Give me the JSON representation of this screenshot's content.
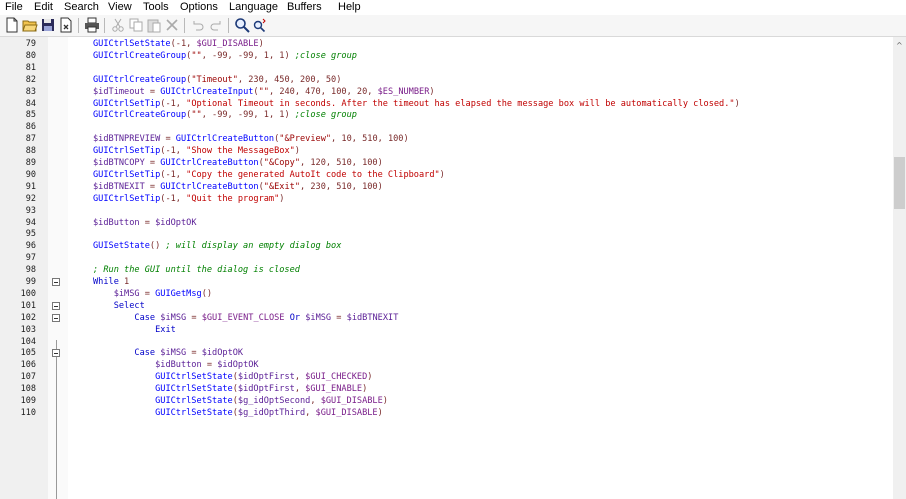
{
  "menu": [
    "File",
    "Edit",
    "Search",
    "View",
    "Tools",
    "Options",
    "Language",
    "Buffers",
    "Help"
  ],
  "toolbar": {
    "icons": [
      "new-file-icon",
      "open-folder-icon",
      "save-icon",
      "close-file-icon",
      "print-icon",
      "cut-icon",
      "copy-icon",
      "paste-icon",
      "delete-icon",
      "undo-icon",
      "redo-icon",
      "find-icon",
      "replace-icon"
    ]
  },
  "editor": {
    "lines": [
      {
        "n": "79",
        "fold": false,
        "segs": [
          [
            "fn",
            "GUICtrlSetState"
          ],
          [
            "op",
            "(-1, "
          ],
          [
            "mac",
            "$GUI_DISABLE"
          ],
          [
            "op",
            ")"
          ]
        ]
      },
      {
        "n": "80",
        "fold": false,
        "segs": [
          [
            "fn",
            "GUICtrlCreateGroup"
          ],
          [
            "op",
            "("
          ],
          [
            "str",
            "\"\""
          ],
          [
            "op",
            ", -99, -99, 1, 1) "
          ],
          [
            "cm",
            ";close group"
          ]
        ]
      },
      {
        "n": "81",
        "fold": false,
        "segs": []
      },
      {
        "n": "82",
        "fold": false,
        "segs": [
          [
            "fn",
            "GUICtrlCreateGroup"
          ],
          [
            "op",
            "("
          ],
          [
            "str",
            "\"Timeout\""
          ],
          [
            "op",
            ", 230, 450, 200, 50)"
          ]
        ]
      },
      {
        "n": "83",
        "fold": false,
        "segs": [
          [
            "var",
            "$idTimeout"
          ],
          [
            "op",
            " = "
          ],
          [
            "fn",
            "GUICtrlCreateInput"
          ],
          [
            "op",
            "("
          ],
          [
            "str",
            "\"\""
          ],
          [
            "op",
            ", 240, 470, 100, 20, "
          ],
          [
            "mac",
            "$ES_NUMBER"
          ],
          [
            "op",
            ")"
          ]
        ]
      },
      {
        "n": "84",
        "fold": false,
        "segs": [
          [
            "fn",
            "GUICtrlSetTip"
          ],
          [
            "op",
            "(-1, "
          ],
          [
            "str2",
            "\"Optional Timeout in seconds. After the timeout has elapsed the message box will be automatically closed.\""
          ],
          [
            "op",
            ")"
          ]
        ]
      },
      {
        "n": "85",
        "fold": false,
        "segs": [
          [
            "fn",
            "GUICtrlCreateGroup"
          ],
          [
            "op",
            "("
          ],
          [
            "str",
            "\"\""
          ],
          [
            "op",
            ", -99, -99, 1, 1) "
          ],
          [
            "cm",
            ";close group"
          ]
        ]
      },
      {
        "n": "86",
        "fold": false,
        "segs": []
      },
      {
        "n": "87",
        "fold": false,
        "segs": [
          [
            "var",
            "$idBTNPREVIEW"
          ],
          [
            "op",
            " = "
          ],
          [
            "fn",
            "GUICtrlCreateButton"
          ],
          [
            "op",
            "("
          ],
          [
            "str",
            "\"&Preview\""
          ],
          [
            "op",
            ", 10, 510, 100)"
          ]
        ]
      },
      {
        "n": "88",
        "fold": false,
        "segs": [
          [
            "fn",
            "GUICtrlSetTip"
          ],
          [
            "op",
            "(-1, "
          ],
          [
            "str2",
            "\"Show the MessageBox\""
          ],
          [
            "op",
            ")"
          ]
        ]
      },
      {
        "n": "89",
        "fold": false,
        "segs": [
          [
            "var",
            "$idBTNCOPY"
          ],
          [
            "op",
            " = "
          ],
          [
            "fn",
            "GUICtrlCreateButton"
          ],
          [
            "op",
            "("
          ],
          [
            "str",
            "\"&Copy\""
          ],
          [
            "op",
            ", 120, 510, 100)"
          ]
        ]
      },
      {
        "n": "90",
        "fold": false,
        "segs": [
          [
            "fn",
            "GUICtrlSetTip"
          ],
          [
            "op",
            "(-1, "
          ],
          [
            "str2",
            "\"Copy the generated AutoIt code to the Clipboard\""
          ],
          [
            "op",
            ")"
          ]
        ]
      },
      {
        "n": "91",
        "fold": false,
        "segs": [
          [
            "var",
            "$idBTNEXIT"
          ],
          [
            "op",
            " = "
          ],
          [
            "fn",
            "GUICtrlCreateButton"
          ],
          [
            "op",
            "("
          ],
          [
            "str",
            "\"&Exit\""
          ],
          [
            "op",
            ", 230, 510, 100)"
          ]
        ]
      },
      {
        "n": "92",
        "fold": false,
        "segs": [
          [
            "fn",
            "GUICtrlSetTip"
          ],
          [
            "op",
            "(-1, "
          ],
          [
            "str2",
            "\"Quit the program\""
          ],
          [
            "op",
            ")"
          ]
        ]
      },
      {
        "n": "93",
        "fold": false,
        "segs": []
      },
      {
        "n": "94",
        "fold": false,
        "segs": [
          [
            "var",
            "$idButton"
          ],
          [
            "op",
            " = "
          ],
          [
            "var",
            "$idOptOK"
          ]
        ]
      },
      {
        "n": "95",
        "fold": false,
        "segs": []
      },
      {
        "n": "96",
        "fold": false,
        "segs": [
          [
            "fn",
            "GUISetState"
          ],
          [
            "op",
            "() "
          ],
          [
            "cm",
            "; will display an empty dialog box"
          ]
        ]
      },
      {
        "n": "97",
        "fold": false,
        "segs": []
      },
      {
        "n": "98",
        "fold": false,
        "segs": [
          [
            "cm",
            "; Run the GUI until the dialog is closed"
          ]
        ]
      },
      {
        "n": "99",
        "fold": true,
        "segs": [
          [
            "kw",
            "While"
          ],
          [
            "op",
            " 1"
          ]
        ]
      },
      {
        "n": "100",
        "fold": false,
        "segs": [
          [
            "op",
            "    "
          ],
          [
            "var",
            "$iMSG"
          ],
          [
            "op",
            " = "
          ],
          [
            "fn",
            "GUIGetMsg"
          ],
          [
            "op",
            "()"
          ]
        ]
      },
      {
        "n": "101",
        "fold": true,
        "segs": [
          [
            "op",
            "    "
          ],
          [
            "kw",
            "Select"
          ]
        ]
      },
      {
        "n": "102",
        "fold": true,
        "segs": [
          [
            "op",
            "        "
          ],
          [
            "kw",
            "Case"
          ],
          [
            "op",
            " "
          ],
          [
            "var",
            "$iMSG"
          ],
          [
            "op",
            " = "
          ],
          [
            "mac",
            "$GUI_EVENT_CLOSE"
          ],
          [
            "op",
            " "
          ],
          [
            "kw",
            "Or"
          ],
          [
            "op",
            " "
          ],
          [
            "var",
            "$iMSG"
          ],
          [
            "op",
            " = "
          ],
          [
            "var",
            "$idBTNEXIT"
          ]
        ]
      },
      {
        "n": "103",
        "fold": false,
        "segs": [
          [
            "op",
            "            "
          ],
          [
            "kw",
            "Exit"
          ]
        ]
      },
      {
        "n": "104",
        "fold": false,
        "segs": []
      },
      {
        "n": "105",
        "fold": true,
        "segs": [
          [
            "op",
            "        "
          ],
          [
            "kw",
            "Case"
          ],
          [
            "op",
            " "
          ],
          [
            "var",
            "$iMSG"
          ],
          [
            "op",
            " = "
          ],
          [
            "var",
            "$idOptOK"
          ]
        ]
      },
      {
        "n": "106",
        "fold": false,
        "segs": [
          [
            "op",
            "            "
          ],
          [
            "var",
            "$idButton"
          ],
          [
            "op",
            " = "
          ],
          [
            "var",
            "$idOptOK"
          ]
        ]
      },
      {
        "n": "107",
        "fold": false,
        "segs": [
          [
            "op",
            "            "
          ],
          [
            "fn",
            "GUICtrlSetState"
          ],
          [
            "op",
            "("
          ],
          [
            "var",
            "$idOptFirst"
          ],
          [
            "op",
            ", "
          ],
          [
            "mac",
            "$GUI_CHECKED"
          ],
          [
            "op",
            ")"
          ]
        ]
      },
      {
        "n": "108",
        "fold": false,
        "segs": [
          [
            "op",
            "            "
          ],
          [
            "fn",
            "GUICtrlSetState"
          ],
          [
            "op",
            "("
          ],
          [
            "var",
            "$idOptFirst"
          ],
          [
            "op",
            ", "
          ],
          [
            "mac",
            "$GUI_ENABLE"
          ],
          [
            "op",
            ")"
          ]
        ]
      },
      {
        "n": "109",
        "fold": false,
        "segs": [
          [
            "op",
            "            "
          ],
          [
            "fn",
            "GUICtrlSetState"
          ],
          [
            "op",
            "("
          ],
          [
            "var",
            "$g_idOptSecond"
          ],
          [
            "op",
            ", "
          ],
          [
            "mac",
            "$GUI_DISABLE"
          ],
          [
            "op",
            ")"
          ]
        ]
      },
      {
        "n": "110",
        "fold": false,
        "segs": [
          [
            "op",
            "            "
          ],
          [
            "fn",
            "GUICtrlSetState"
          ],
          [
            "op",
            "("
          ],
          [
            "var",
            "$g_idOptThird"
          ],
          [
            "op",
            ", "
          ],
          [
            "mac",
            "$GUI_DISABLE"
          ],
          [
            "op",
            ")"
          ]
        ]
      }
    ]
  },
  "scrollbar": {
    "up_arrow": "^"
  }
}
